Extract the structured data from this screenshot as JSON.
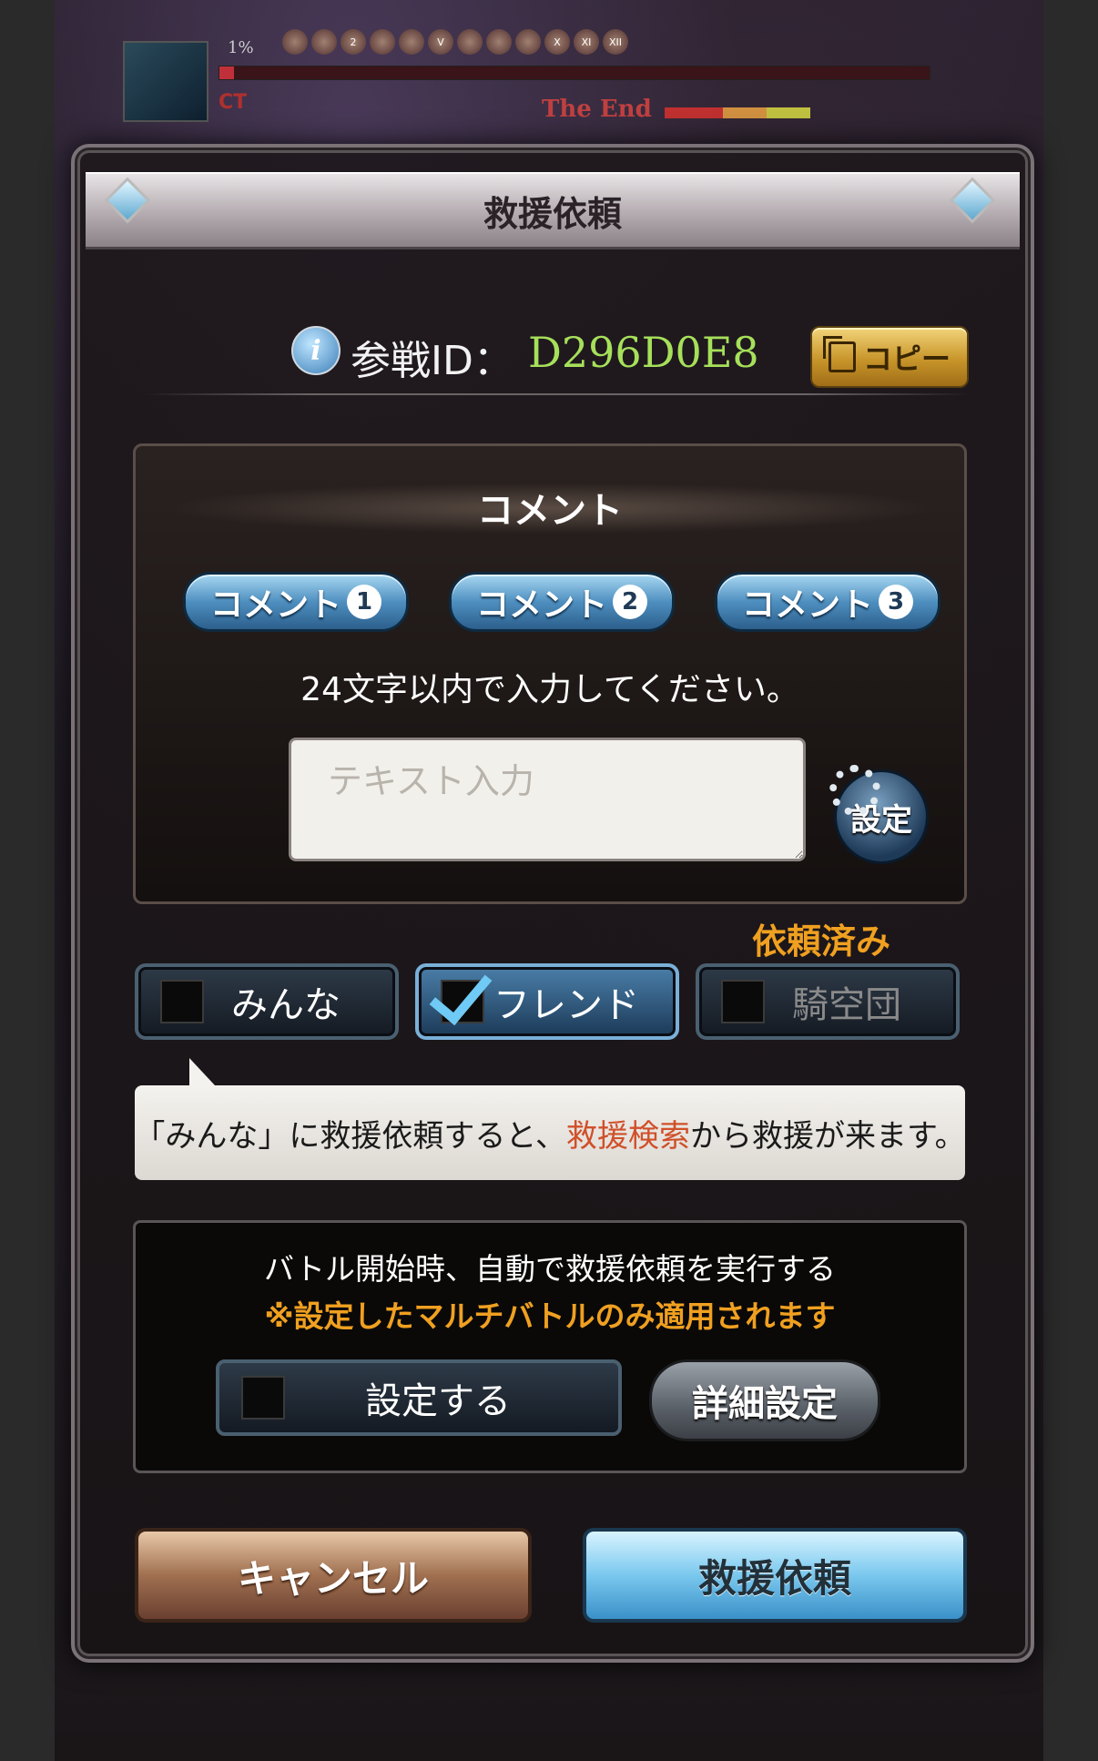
{
  "hud": {
    "hp_percent": "1%",
    "status_icons": [
      "",
      "",
      "2",
      "",
      "",
      "V",
      "",
      "",
      "",
      "X",
      "XI",
      "XII"
    ],
    "ct_label": "CT",
    "special_label": "The End",
    "hp_fraction": 0.02
  },
  "dialog": {
    "title": "救援依頼",
    "raid_label": "参戦ID：",
    "raid_id": "D296D0E8",
    "copy_label": "コピー"
  },
  "comment": {
    "title": "コメント",
    "presets": [
      {
        "label": "コメント",
        "num": "1"
      },
      {
        "label": "コメント",
        "num": "2"
      },
      {
        "label": "コメント",
        "num": "3"
      }
    ],
    "instruction": "24文字以内で入力してください。",
    "input_placeholder": "テキスト入力",
    "settings_label": "設定"
  },
  "targets": {
    "requested_label": "依頼済み",
    "everyone": "みんな",
    "friend": "フレンド",
    "crew": "騎空団"
  },
  "tooltip": {
    "part1": "「みんな」に救援依頼すると、",
    "highlight": "救援検索",
    "part2": "から救援が来ます。"
  },
  "auto": {
    "line1": "バトル開始時、自動で救援依頼を実行する",
    "line2": "※設定したマルチバトルのみ適用されます",
    "set_label": "設定する",
    "detail_label": "詳細設定"
  },
  "buttons": {
    "cancel": "キャンセル",
    "rescue": "救援依頼"
  },
  "colors": {
    "raid_id": "#a6e05a",
    "warning": "#f0a020",
    "highlight": "#d0502a"
  }
}
